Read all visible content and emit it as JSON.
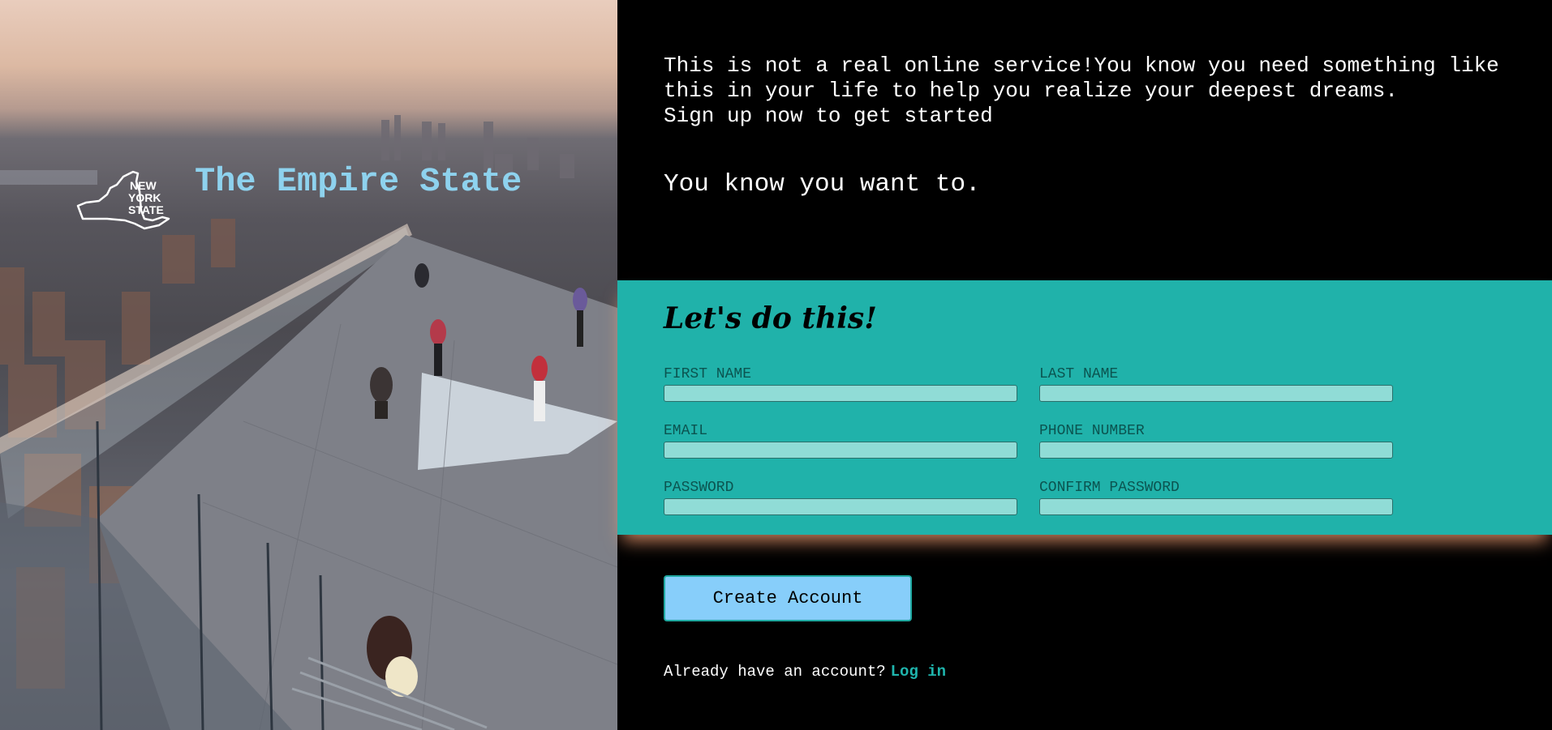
{
  "hero": {
    "logo_text": [
      "NEW",
      "YORK",
      "STATE"
    ],
    "title": "The Empire State"
  },
  "intro": {
    "line1": "This is not a real online service!You know you need something like",
    "line2": "this in your life to help you realize your deepest dreams.",
    "line3": "Sign up now to get started",
    "tagline": "You know you want to."
  },
  "form": {
    "heading": "Let's do this!",
    "fields": {
      "first_name": {
        "label": "FIRST NAME",
        "value": ""
      },
      "last_name": {
        "label": "LAST NAME",
        "value": ""
      },
      "email": {
        "label": "EMAIL",
        "value": ""
      },
      "phone": {
        "label": "PHONE NUMBER",
        "value": ""
      },
      "password": {
        "label": "PASSWORD",
        "value": ""
      },
      "confirm_password": {
        "label": "CONFIRM PASSWORD",
        "value": ""
      }
    },
    "submit_label": "Create Account"
  },
  "footer": {
    "prompt": "Already have an account?",
    "login_label": "Log in"
  },
  "colors": {
    "accent_band": "#20b2aa",
    "hero_title": "#8ed2ee",
    "button": "#87cefa",
    "link": "#1fb5ad"
  }
}
